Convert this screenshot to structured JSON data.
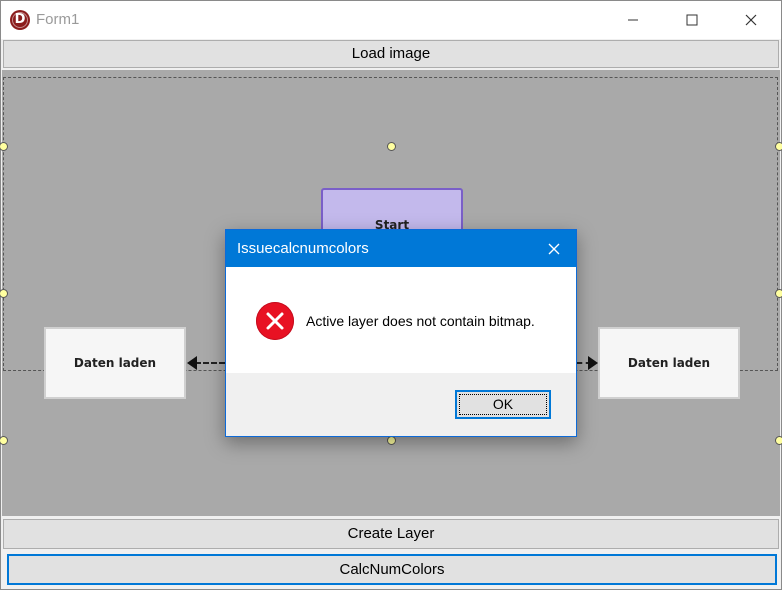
{
  "window": {
    "title": "Form1",
    "app_icon": "D",
    "controls": {
      "minimize": "minimize-icon",
      "maximize": "maximize-icon",
      "close": "close-icon"
    }
  },
  "buttons": {
    "load_image": "Load image",
    "create_layer": "Create Layer",
    "calc_num_colors": "CalcNumColors"
  },
  "diagram": {
    "start_label": "Start",
    "left_node_label": "Daten laden",
    "right_node_label": "Daten laden"
  },
  "dialog": {
    "title": "Issuecalcnumcolors",
    "message": "Active layer does not contain bitmap.",
    "ok_label": "OK",
    "icon": "error-icon"
  },
  "colors": {
    "accent": "#0078d7",
    "canvas": "#a9a9a9",
    "start_fill": "#c3b9ec",
    "start_border": "#7a5fc8",
    "error": "#e81123"
  }
}
